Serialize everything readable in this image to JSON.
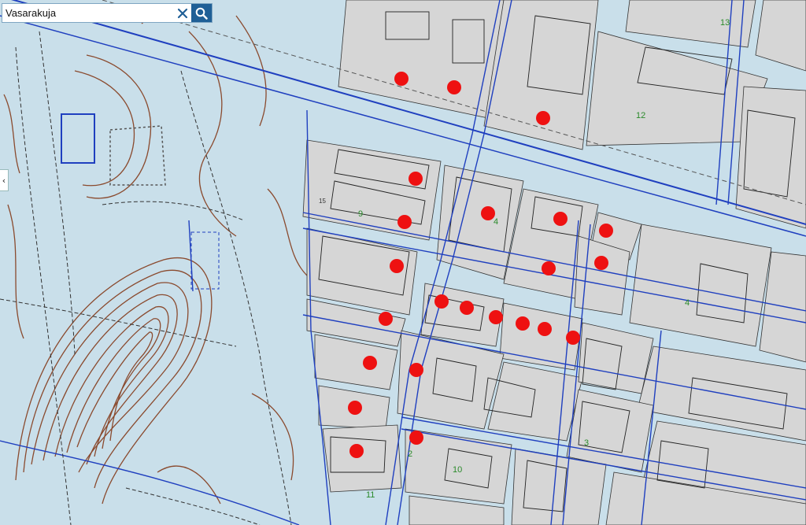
{
  "search": {
    "value": "Vasarakuja",
    "placeholder": "",
    "clear_icon": "close-icon",
    "search_icon": "search-icon"
  },
  "side_panel_toggle": {
    "icon": "chevron-left-icon",
    "glyph": "‹"
  },
  "map": {
    "colors": {
      "background": "#c9dfea",
      "parcel_fill": "#d6d6d6",
      "street_lines": "#1f3fbf",
      "terrain_contours": "#8a4a2e",
      "markers": "#ee1111",
      "labels": "#2a8a2a"
    },
    "block_labels": [
      "13",
      "12",
      "9",
      "4",
      "4",
      "15",
      "3",
      "10",
      "11",
      "2"
    ],
    "marker_count": 27
  }
}
